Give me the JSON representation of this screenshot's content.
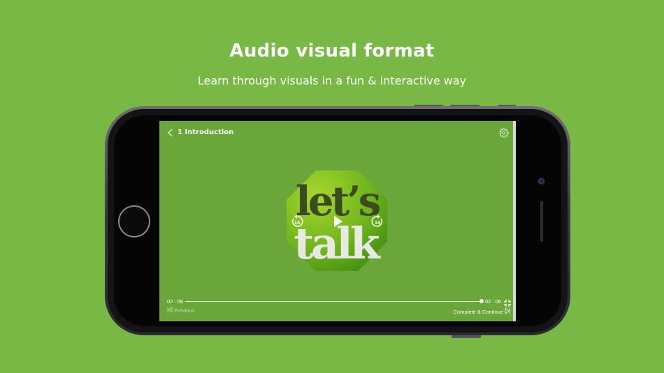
{
  "hero": {
    "title": "Audio visual format",
    "subtitle": "Learn through visuals in a fun & interactive way"
  },
  "player": {
    "lesson_title": "1 Introduction",
    "current_time": "02 : 06",
    "total_time": "02 : 06",
    "progress": 1.0,
    "rewind_label": "10",
    "forward_label": "10",
    "previous_label": "Previous",
    "next_label": "Complete & Continue"
  },
  "artwork": {
    "line1": "let’s",
    "line2": "talk"
  },
  "colors": {
    "background": "#77b944",
    "screen": "#6aa63a",
    "logo_green_light": "#9fd02a",
    "logo_green_dark": "#3f8a12",
    "logo_text_dark": "#3b4a1f",
    "logo_text_light": "#e9e9e4"
  },
  "icons": [
    "back-chevron-icon",
    "settings-gear-icon",
    "rewind-10-icon",
    "play-icon",
    "forward-10-icon",
    "fullscreen-icon",
    "previous-icon",
    "next-icon"
  ]
}
